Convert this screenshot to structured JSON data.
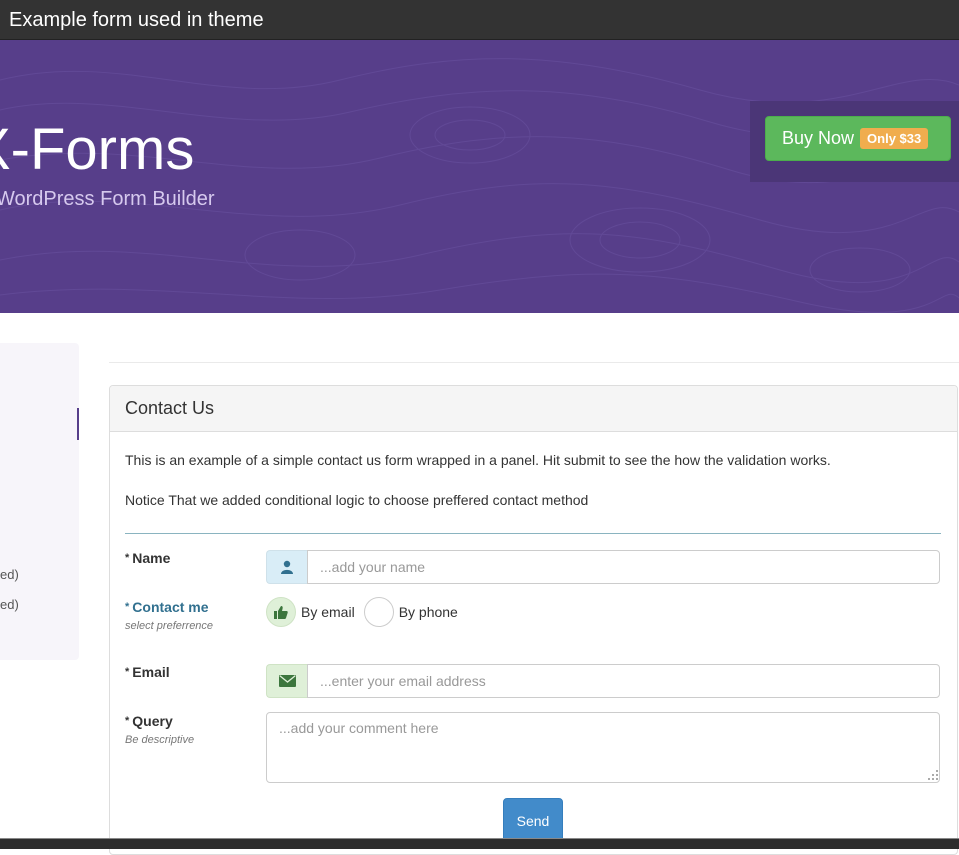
{
  "window": {
    "title": "Example form used in theme"
  },
  "hero": {
    "title": "X-Forms",
    "subtitle": "WordPress Form Builder",
    "buy_label": "Buy Now",
    "buy_badge": "Only $33"
  },
  "sidebar": {
    "lines": [
      "ed)",
      "ed)"
    ]
  },
  "panel": {
    "heading": "Contact Us",
    "intro1": "This is an example of a simple contact us form wrapped in a panel. Hit submit to see the how the validation works.",
    "intro2": "Notice That we added conditional logic to choose preffered contact method"
  },
  "form": {
    "required_mark": "*",
    "name": {
      "label": "Name",
      "placeholder": "...add your name",
      "icon": "user-icon"
    },
    "contact": {
      "label": "Contact me",
      "hint": "select preferrence",
      "options": [
        {
          "label": "By email",
          "checked": true,
          "icon": "thumbs-up-icon"
        },
        {
          "label": "By phone",
          "checked": false
        }
      ]
    },
    "email": {
      "label": "Email",
      "placeholder": "...enter your email address",
      "icon": "envelope-icon"
    },
    "query": {
      "label": "Query",
      "hint": "Be descriptive",
      "placeholder": "...add your comment here"
    },
    "submit_label": "Send"
  },
  "colors": {
    "hero_bg": "#573e8a",
    "buy_green": "#5cb85c",
    "badge_orange": "#f0ad4e",
    "send_blue": "#428bca"
  }
}
